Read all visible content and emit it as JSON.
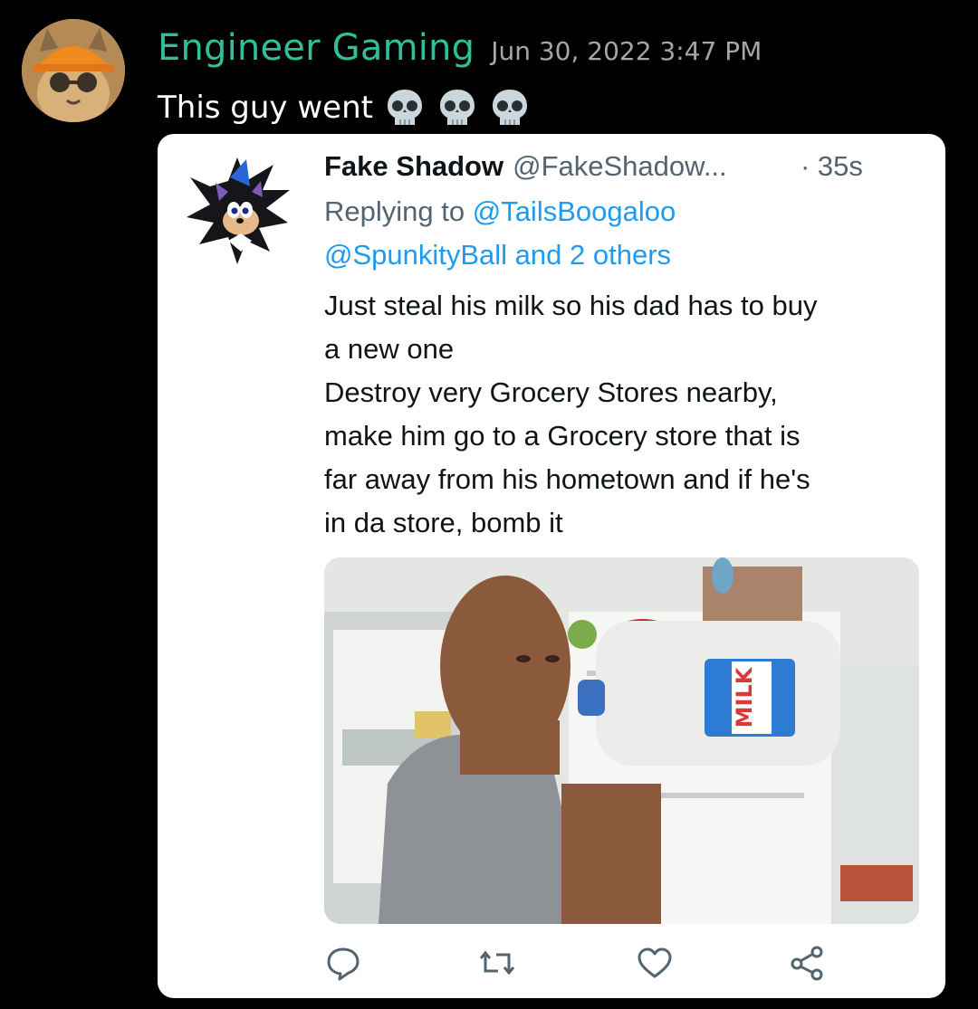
{
  "message": {
    "username": "Engineer Gaming",
    "timestamp": "Jun 30, 2022 3:47 PM",
    "text": "This guy went",
    "emojis": [
      "skull-emoji",
      "skull-emoji",
      "skull-emoji"
    ]
  },
  "tweet": {
    "display_name": "Fake Shadow",
    "handle": "@FakeShadow...",
    "time": "· 35s",
    "replying_label": "Replying to",
    "mention_1": "@TailsBoogaloo",
    "mention_2": "@SpunkityBall and 2 others",
    "body_lines": [
      "Just steal his milk so his dad has to buy",
      "a new one",
      "Destroy very Grocery Stores nearby,",
      "make him go to a Grocery store that is",
      "far away from his hometown and if he's",
      "in da store, bomb it"
    ],
    "media": {
      "milk_label": "MILK"
    },
    "actions": [
      "reply-icon",
      "retweet-icon",
      "like-icon",
      "share-icon"
    ]
  },
  "colors": {
    "username": "#2fbf9a",
    "timestamp": "#a3a6aa",
    "mention": "#1d9bf0",
    "tweet_text": "#0f1419",
    "tweet_secondary": "#536471"
  }
}
